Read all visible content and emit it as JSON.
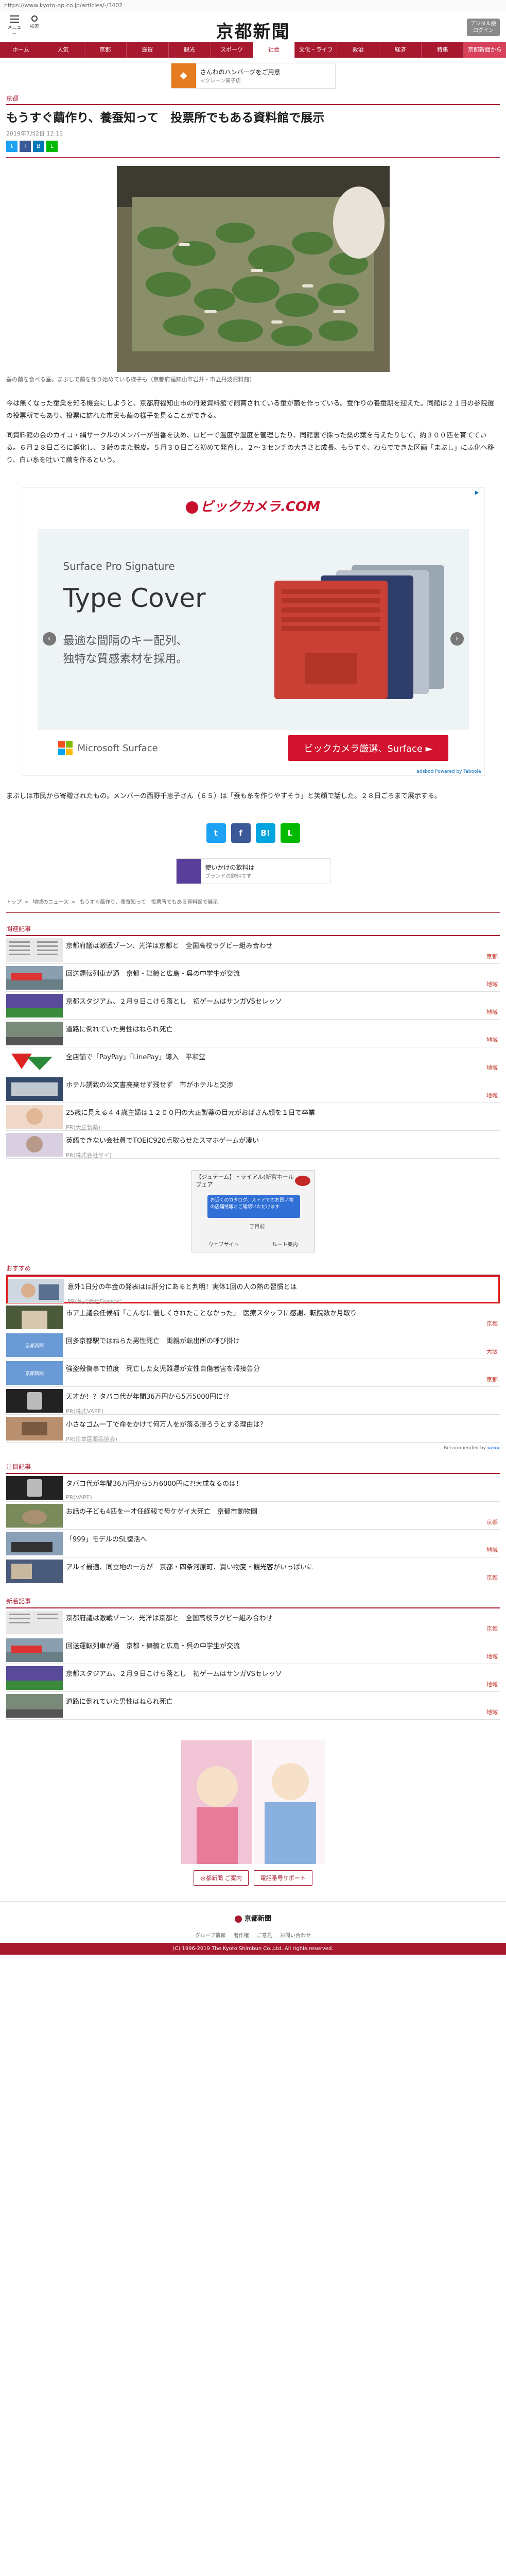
{
  "url": "https://www.kyoto-np.co.jp/articles/-/3402",
  "header": {
    "menu_label": "メニュー",
    "search_label": "検索",
    "logo": "京都新聞",
    "digital_label_1": "デジタル版",
    "digital_label_2": "ログイン"
  },
  "nav": [
    "ホーム",
    "人気",
    "京都",
    "滋賀",
    "観光",
    "スポーツ",
    "社会",
    "文化・ライフ",
    "政治",
    "経済",
    "特集",
    "京都新聞から"
  ],
  "top_ad": {
    "title": "さんわのハンバーグをご用意",
    "sub": "マクレーン菓子店"
  },
  "article": {
    "section": "京都",
    "title": "もうすぐ繭作り、養蚕知って　投票所でもある資料館で展示",
    "date": "2019年7月2日 12:13",
    "caption": "蚕の繭を食べる蚕。まぶしで繭を作り始めている様子も（京都府福知山市岩井・市立丹波資料館）",
    "p1": "今は無くなった蚕業を知る機会にしようと、京都府福知山市の丹波資料館で飼育されている蚕が繭を作っている。蚕作りの養蚕期を迎えた。同館は２１日の参院選の投票所でもあり、投票に訪れた市民も繭の様子を見ることができる。",
    "p2": "同資料館の会のカイコ・絹サークルのメンバーが当番を決め、ロビーで温度や湿度を管理したり、同館裏で採った桑の葉を与えたりして、約３００匹を育てている。６月２８日ごろに孵化し、３齢のまた脱皮。５月３０日ごろ初めて発育し、２～３センチの大きさと成長。もうすぐ、わらでできた区画「まぶし」にふ化ヘ移り、白い糸を吐いて繭を作るという。",
    "p3": "まぶしは市民から寄贈されたもの。メンバーの西野千恵子さん（６５）は「蚕も糸を作りやすそう」と笑顔で話した。２８日ごろまで展示する。"
  },
  "big_ad": {
    "brand": "ビックカメラ.COM",
    "line1": "Surface Pro Signature",
    "line2": "Type Cover",
    "line3": "最適な間隔のキー配列、",
    "line4": "独特な質感素材を採用。",
    "microsoft": "Microsoft Surface",
    "cta": "ビックカメラ厳選、Surface ►",
    "powered": "adsbod Powered by Taboola"
  },
  "share": {
    "twitter": "t",
    "facebook": "f",
    "hatena": "B!",
    "line": "L"
  },
  "mid_ad": {
    "title": "使いかけの飲料は",
    "sub": "ブランドの飲料です"
  },
  "breadcrumb": [
    "トップ",
    "地域のニュース",
    "もうすぐ繭作り、養蚕知って　投票所でもある資料館で展示"
  ],
  "related": {
    "heading": "関連記事",
    "items": [
      {
        "title": "京都府議は激戦ゾーン、光洋は京都と　全国高校ラグビー組み合わせ",
        "tag": "京都"
      },
      {
        "title": "回送運転列車が通　京都・舞鶴と広島・呉の中学生が交流",
        "tag": "地域"
      },
      {
        "title": "京都スタジアム、２月９日こけら落とし　初ゲームはサンガVSセレッソ",
        "tag": "地域"
      },
      {
        "title": "道路に倒れていた男性はねられ死亡",
        "tag": "地域"
      },
      {
        "title": "全店舗で「PayPay」「LinePay」導入　平和堂",
        "tag": "地域"
      },
      {
        "title": "ホテル誘致の公文書廃棄せず残せず　市がホテルと交渉",
        "tag": "地域"
      },
      {
        "title": "25歳に見える４４歳主婦は１２００円の大正製薬の目元がおばさん顔を１日で卒業",
        "pr": "PR(大正製薬)"
      },
      {
        "title": "英語できない会社員でTOEIC920点取らせたスマホゲームが凄い",
        "pr": "PR(株式会社サイ)"
      }
    ]
  },
  "map_ad": {
    "t1": "【ジュテーム】トライアル(新宮ホール",
    "t2": "ブェア",
    "bubble": "お近くのカタログ、ストアでのお買い物の店舗情報とご確認いただけます",
    "pin": "丁目前",
    "btn1": "ウェブサイト",
    "btn2": "ルート案内"
  },
  "recommend": {
    "heading": "おすすめ",
    "items": [
      {
        "title": "意外1日分の年金の発表はは肝分にあると判明！実体1回の人の熱の習慣とは",
        "pr": "PR(株式会社Dreaps)"
      },
      {
        "title": "市ア上議会任候補「こんなに優しくされたことなかった」　医療スタッフに感謝、転院数か月取り",
        "tag": "京都"
      },
      {
        "title": "回多京都駅ではねらた男性死亡　両親が転出所の呼び掛け",
        "tag": "大阪"
      },
      {
        "title": "強盗殺傷事で拉度　死亡した女児難運が安性自傷者害を帰接告分",
        "tag": "京都"
      },
      {
        "title": "天才か！？タバコ代が年間36万円から5万5000円に!?",
        "pr": "PR(株式VAPE)"
      },
      {
        "title": "小さなゴム一丁で命をかけて何万人をが落る浸ろうとする理由は？",
        "pr": "PR(日本医薬品協会)"
      }
    ],
    "powered": "Recommended by"
  },
  "popular": {
    "heading": "注目記事",
    "items": [
      {
        "title": "タバコ代が年間36万円から5万6000円に?!大成なるのは！",
        "pr": "PR(VAPE)"
      },
      {
        "title": "お話の子ども4匹を一才任経報で母ケゲイ大死亡　京都市動物園",
        "tag": "京都"
      },
      {
        "title": "「999」モデルのSL復活へ",
        "tag": "地域"
      },
      {
        "title": "アルイ最適、同立地の一方が　京都・四条河原町、買い物変・観光客がいっぱいに",
        "tag": "京都"
      }
    ]
  },
  "newest": {
    "heading": "新着記事",
    "items": [
      {
        "title": "京都府議は激戦ゾーン、光洋は京都と　全国高校ラグビー組み合わせ",
        "tag": "京都"
      },
      {
        "title": "回送運転列車が通　京都・舞鶴と広島・呉の中学生が交流",
        "tag": "地域"
      },
      {
        "title": "京都スタジアム、２月９日こけら落とし　初ゲームはサンガVSセレッソ",
        "tag": "地域"
      },
      {
        "title": "道路に倒れていた男性はねられ死亡",
        "tag": "地域"
      }
    ]
  },
  "bottom_buttons": [
    "京都新聞 ご案内",
    "電話番号サポート"
  ],
  "footer": {
    "logo": "京都新聞",
    "links": [
      "グループ情報",
      "著作権",
      "ご意見",
      "お問い合わせ"
    ],
    "copyright": "(C) 1996-2019 The Kyoto Shimbun Co.,Ltd. All rights reserved."
  }
}
